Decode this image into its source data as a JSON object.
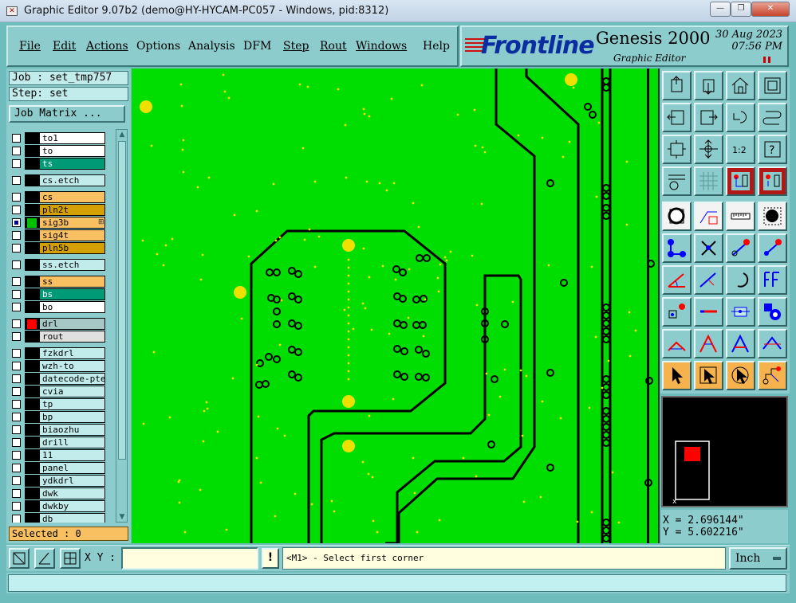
{
  "window": {
    "title": "Graphic Editor 9.07b2 (demo@HY-HYCAM-PC057 - Windows, pid:8312)",
    "minimize": "—",
    "maximize": "❐",
    "close": "✕"
  },
  "menu": [
    "File",
    "Edit",
    "Actions",
    "Options",
    "Analysis",
    "DFM",
    "Step",
    "Rout",
    "Windows",
    "Help"
  ],
  "brand": {
    "logo": "Frontline",
    "product": "Genesis 2000",
    "subtitle": "Graphic Editor",
    "date": "30 Aug 2023",
    "time": "07:56 PM"
  },
  "job": {
    "job_label": "Job : set_tmp757",
    "step_label": "Step: set",
    "matrix_button": "Job Matrix ..."
  },
  "layers": [
    {
      "name": "to1",
      "color": "#ffffff",
      "text": "#000000",
      "state": "off"
    },
    {
      "name": "to",
      "color": "#ffffff",
      "text": "#000000",
      "state": "off"
    },
    {
      "name": "ts",
      "color": "#009a76",
      "text": "#ffffff",
      "state": "off"
    },
    {
      "name": "cs.etch",
      "color": "#c2ecec",
      "text": "#000000",
      "state": "off"
    },
    {
      "name": "cs",
      "color": "#f8c060",
      "text": "#000000",
      "state": "off"
    },
    {
      "name": "pln2t",
      "color": "#d4a000",
      "text": "#000000",
      "state": "off"
    },
    {
      "name": "sig3b",
      "color": "#f8c060",
      "text": "#000000",
      "state": "active",
      "swatch": "#00c000",
      "affected": "⊞"
    },
    {
      "name": "sig4t",
      "color": "#f8c060",
      "text": "#000000",
      "state": "off"
    },
    {
      "name": "pln5b",
      "color": "#d4a000",
      "text": "#000000",
      "state": "off"
    },
    {
      "name": "ss.etch",
      "color": "#c2ecec",
      "text": "#000000",
      "state": "off"
    },
    {
      "name": "ss",
      "color": "#f8c060",
      "text": "#000000",
      "state": "off"
    },
    {
      "name": "bs",
      "color": "#009a76",
      "text": "#ffffff",
      "state": "off"
    },
    {
      "name": "bo",
      "color": "#ffffff",
      "text": "#000000",
      "state": "off"
    },
    {
      "name": "drl",
      "color": "#a7c6c6",
      "text": "#000000",
      "state": "off",
      "swatch": "#ff0000"
    },
    {
      "name": "rout",
      "color": "#e0e0e0",
      "text": "#000000",
      "state": "off"
    },
    {
      "name": "fzkdrl",
      "color": "#c2ecec",
      "text": "#000000",
      "state": "off"
    },
    {
      "name": "wzh-to",
      "color": "#c2ecec",
      "text": "#000000",
      "state": "off"
    },
    {
      "name": "datecode-pte",
      "color": "#c2ecec",
      "text": "#000000",
      "state": "off"
    },
    {
      "name": "cvia",
      "color": "#c2ecec",
      "text": "#000000",
      "state": "off"
    },
    {
      "name": "tp",
      "color": "#c2ecec",
      "text": "#000000",
      "state": "off"
    },
    {
      "name": "bp",
      "color": "#c2ecec",
      "text": "#000000",
      "state": "off"
    },
    {
      "name": "biaozhu",
      "color": "#c2ecec",
      "text": "#000000",
      "state": "off"
    },
    {
      "name": "drill",
      "color": "#c2ecec",
      "text": "#000000",
      "state": "off"
    },
    {
      "name": "11",
      "color": "#c2ecec",
      "text": "#000000",
      "state": "off"
    },
    {
      "name": "panel",
      "color": "#c2ecec",
      "text": "#000000",
      "state": "off"
    },
    {
      "name": "ydkdrl",
      "color": "#c2ecec",
      "text": "#000000",
      "state": "off"
    },
    {
      "name": "dwk",
      "color": "#c2ecec",
      "text": "#000000",
      "state": "off"
    },
    {
      "name": "dwkby",
      "color": "#c2ecec",
      "text": "#000000",
      "state": "off"
    },
    {
      "name": "db",
      "color": "#c2ecec",
      "text": "#000000",
      "state": "off"
    }
  ],
  "selected_label": "Selected : 0",
  "coords": {
    "x": "X = 2.696144\"",
    "y": "Y = 5.602216\""
  },
  "minimap_label": "x",
  "canvas": {
    "copper": "#00dd00",
    "trace": "#000000",
    "pad": "#f0e000"
  },
  "tools": {
    "zoom_ratio_label": "1:2",
    "help_label": "?"
  },
  "bottom": {
    "xy_label": "X Y :",
    "xy_value": "",
    "info_button": "!",
    "prompt": "<M1> - Select first corner",
    "units": "Inch"
  },
  "status_line": ""
}
